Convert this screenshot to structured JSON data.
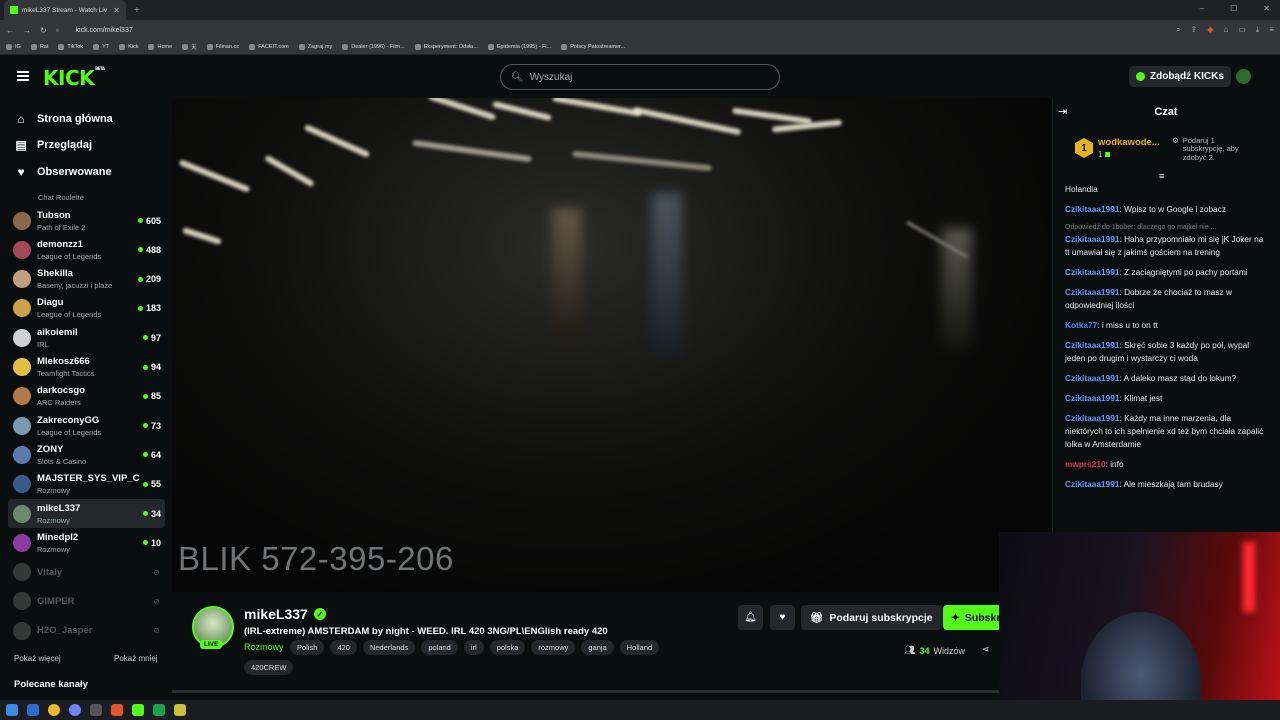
{
  "browser": {
    "tab_title": "mikeL337 Stream - Watch Liv",
    "url": "kick.com/mikel337",
    "bookmarks": [
      "IG",
      "Rat",
      "TikTok",
      "YT",
      "Kick",
      "Home",
      "天",
      "Filman.cc",
      "FACEIT.com",
      "Zagraj.my",
      "Dealer (1996) - Film...",
      "Eksperyment: Odsła...",
      "Epidemia (1995) - Fi...",
      "Polscy Patostreamer..."
    ]
  },
  "header": {
    "logo": "KICK",
    "logo_badge": "BETA",
    "search_placeholder": "Wyszukaj",
    "get_kicks": "Zdobądź KICKs"
  },
  "sidebar": {
    "nav": [
      {
        "label": "Strona główna",
        "icon": "home-icon"
      },
      {
        "label": "Przeglądaj",
        "icon": "browse-icon"
      },
      {
        "label": "Obserwowane",
        "icon": "heart-icon"
      }
    ],
    "partial_category": "Chat Roulette",
    "channels": [
      {
        "name": "Tubson",
        "category": "Path of Exile 2",
        "viewers": "605"
      },
      {
        "name": "demonzz1",
        "category": "League of Legends",
        "viewers": "488"
      },
      {
        "name": "Shekilla",
        "category": "Baseny, jacuzzi i plaże",
        "viewers": "209"
      },
      {
        "name": "Diagu",
        "category": "League of Legends",
        "viewers": "183"
      },
      {
        "name": "aikoiemil",
        "category": "IRL",
        "viewers": "97"
      },
      {
        "name": "Mlekosz666",
        "category": "Teamfight Tactics",
        "viewers": "94"
      },
      {
        "name": "darkocsgo",
        "category": "ARC Raiders",
        "viewers": "85"
      },
      {
        "name": "ZakreconyGG",
        "category": "League of Legends",
        "viewers": "73"
      },
      {
        "name": "ZONY",
        "category": "Slots & Casino",
        "viewers": "64"
      },
      {
        "name": "MAJSTER_SYS_VIP_C",
        "category": "Rozmowy",
        "viewers": "55"
      },
      {
        "name": "mikeL337",
        "category": "Rozmowy",
        "viewers": "34"
      },
      {
        "name": "Minedpl2",
        "category": "Rozmowy",
        "viewers": "10"
      }
    ],
    "offline": [
      "Vitaly",
      "GIMPER",
      "H2O_Jasper"
    ],
    "show_more": "Pokaż więcej",
    "show_less": "Pokaż mniej",
    "recommended": "Polecane kanały"
  },
  "video": {
    "overlay_text": "BLIK 572-395-206"
  },
  "stream": {
    "live_badge": "LIVE",
    "name": "mikeL337",
    "title": "(IRL-extreme) AMSTERDAM by night -  WEED. IRL 420 3NG/PL\\ENGlish ready 420",
    "category": "Rozmowy",
    "tags": [
      "Polish",
      "420",
      "Nederlands",
      "poland",
      "irl",
      "polska",
      "rozmowy",
      "ganja",
      "Holland"
    ],
    "tag_extra": "420CREW",
    "gift_label": "Podaruj subskrypcje",
    "subscribe_label": "Subskrybuj",
    "viewers_count": "34",
    "viewers_label": "Widzów"
  },
  "chat": {
    "title": "Czat",
    "pinned": {
      "rank": "1",
      "name": "wodkawode...",
      "count": "1",
      "info": "Podaruj 1 subskrypcję, aby zdobyć 2."
    },
    "messages": [
      {
        "user": "",
        "text": "Holandia",
        "color": "#e8e8e8"
      },
      {
        "user": "Czikitaaa1991",
        "text": "Wpisz to w Google i zobacz",
        "color": "#5b9bff"
      },
      {
        "reply": "Odpowiedź do 1bober: dlaczego go majkel nie ..."
      },
      {
        "user": "Czikitaaa1991",
        "text": "Haha przypomniało mi się jK Joker na tt umawiał się z jakimś gościem na trening",
        "color": "#5b9bff"
      },
      {
        "user": "Czikitaaa1991",
        "text": "Z zaciągniętymi po pachy portami",
        "color": "#5b9bff"
      },
      {
        "user": "Czikitaaa1991",
        "text": "Dobrze że chociaż to masz w odpowiedniej ilości",
        "color": "#5b9bff"
      },
      {
        "user": "Kotka77",
        "text": "i miss u to on tt",
        "color": "#4f86f7"
      },
      {
        "user": "Czikitaaa1991",
        "text": "Skręć sobie 3 każdy po pół, wypal jeden po drugim i wystarczy ci woda",
        "color": "#5b9bff"
      },
      {
        "user": "Czikitaaa1991",
        "text": "A daleko masz stąd do lokum?",
        "color": "#5b9bff"
      },
      {
        "user": "Czikitaaa1991",
        "text": "Klimat jest",
        "color": "#5b9bff"
      },
      {
        "user": "Czikitaaa1991",
        "text": "Każdy ma inne marzenia, dla niektórych to ich spełnienie xd też bym chciała zapalić lolka w Amsterdamie",
        "color": "#5b9bff"
      },
      {
        "user": "mwprs210",
        "text": "info",
        "color": "#e0354a"
      },
      {
        "user": "Czikitaaa1991",
        "text": "Ale mieszkają tam brudasy",
        "color": "#5b9bff"
      }
    ]
  }
}
